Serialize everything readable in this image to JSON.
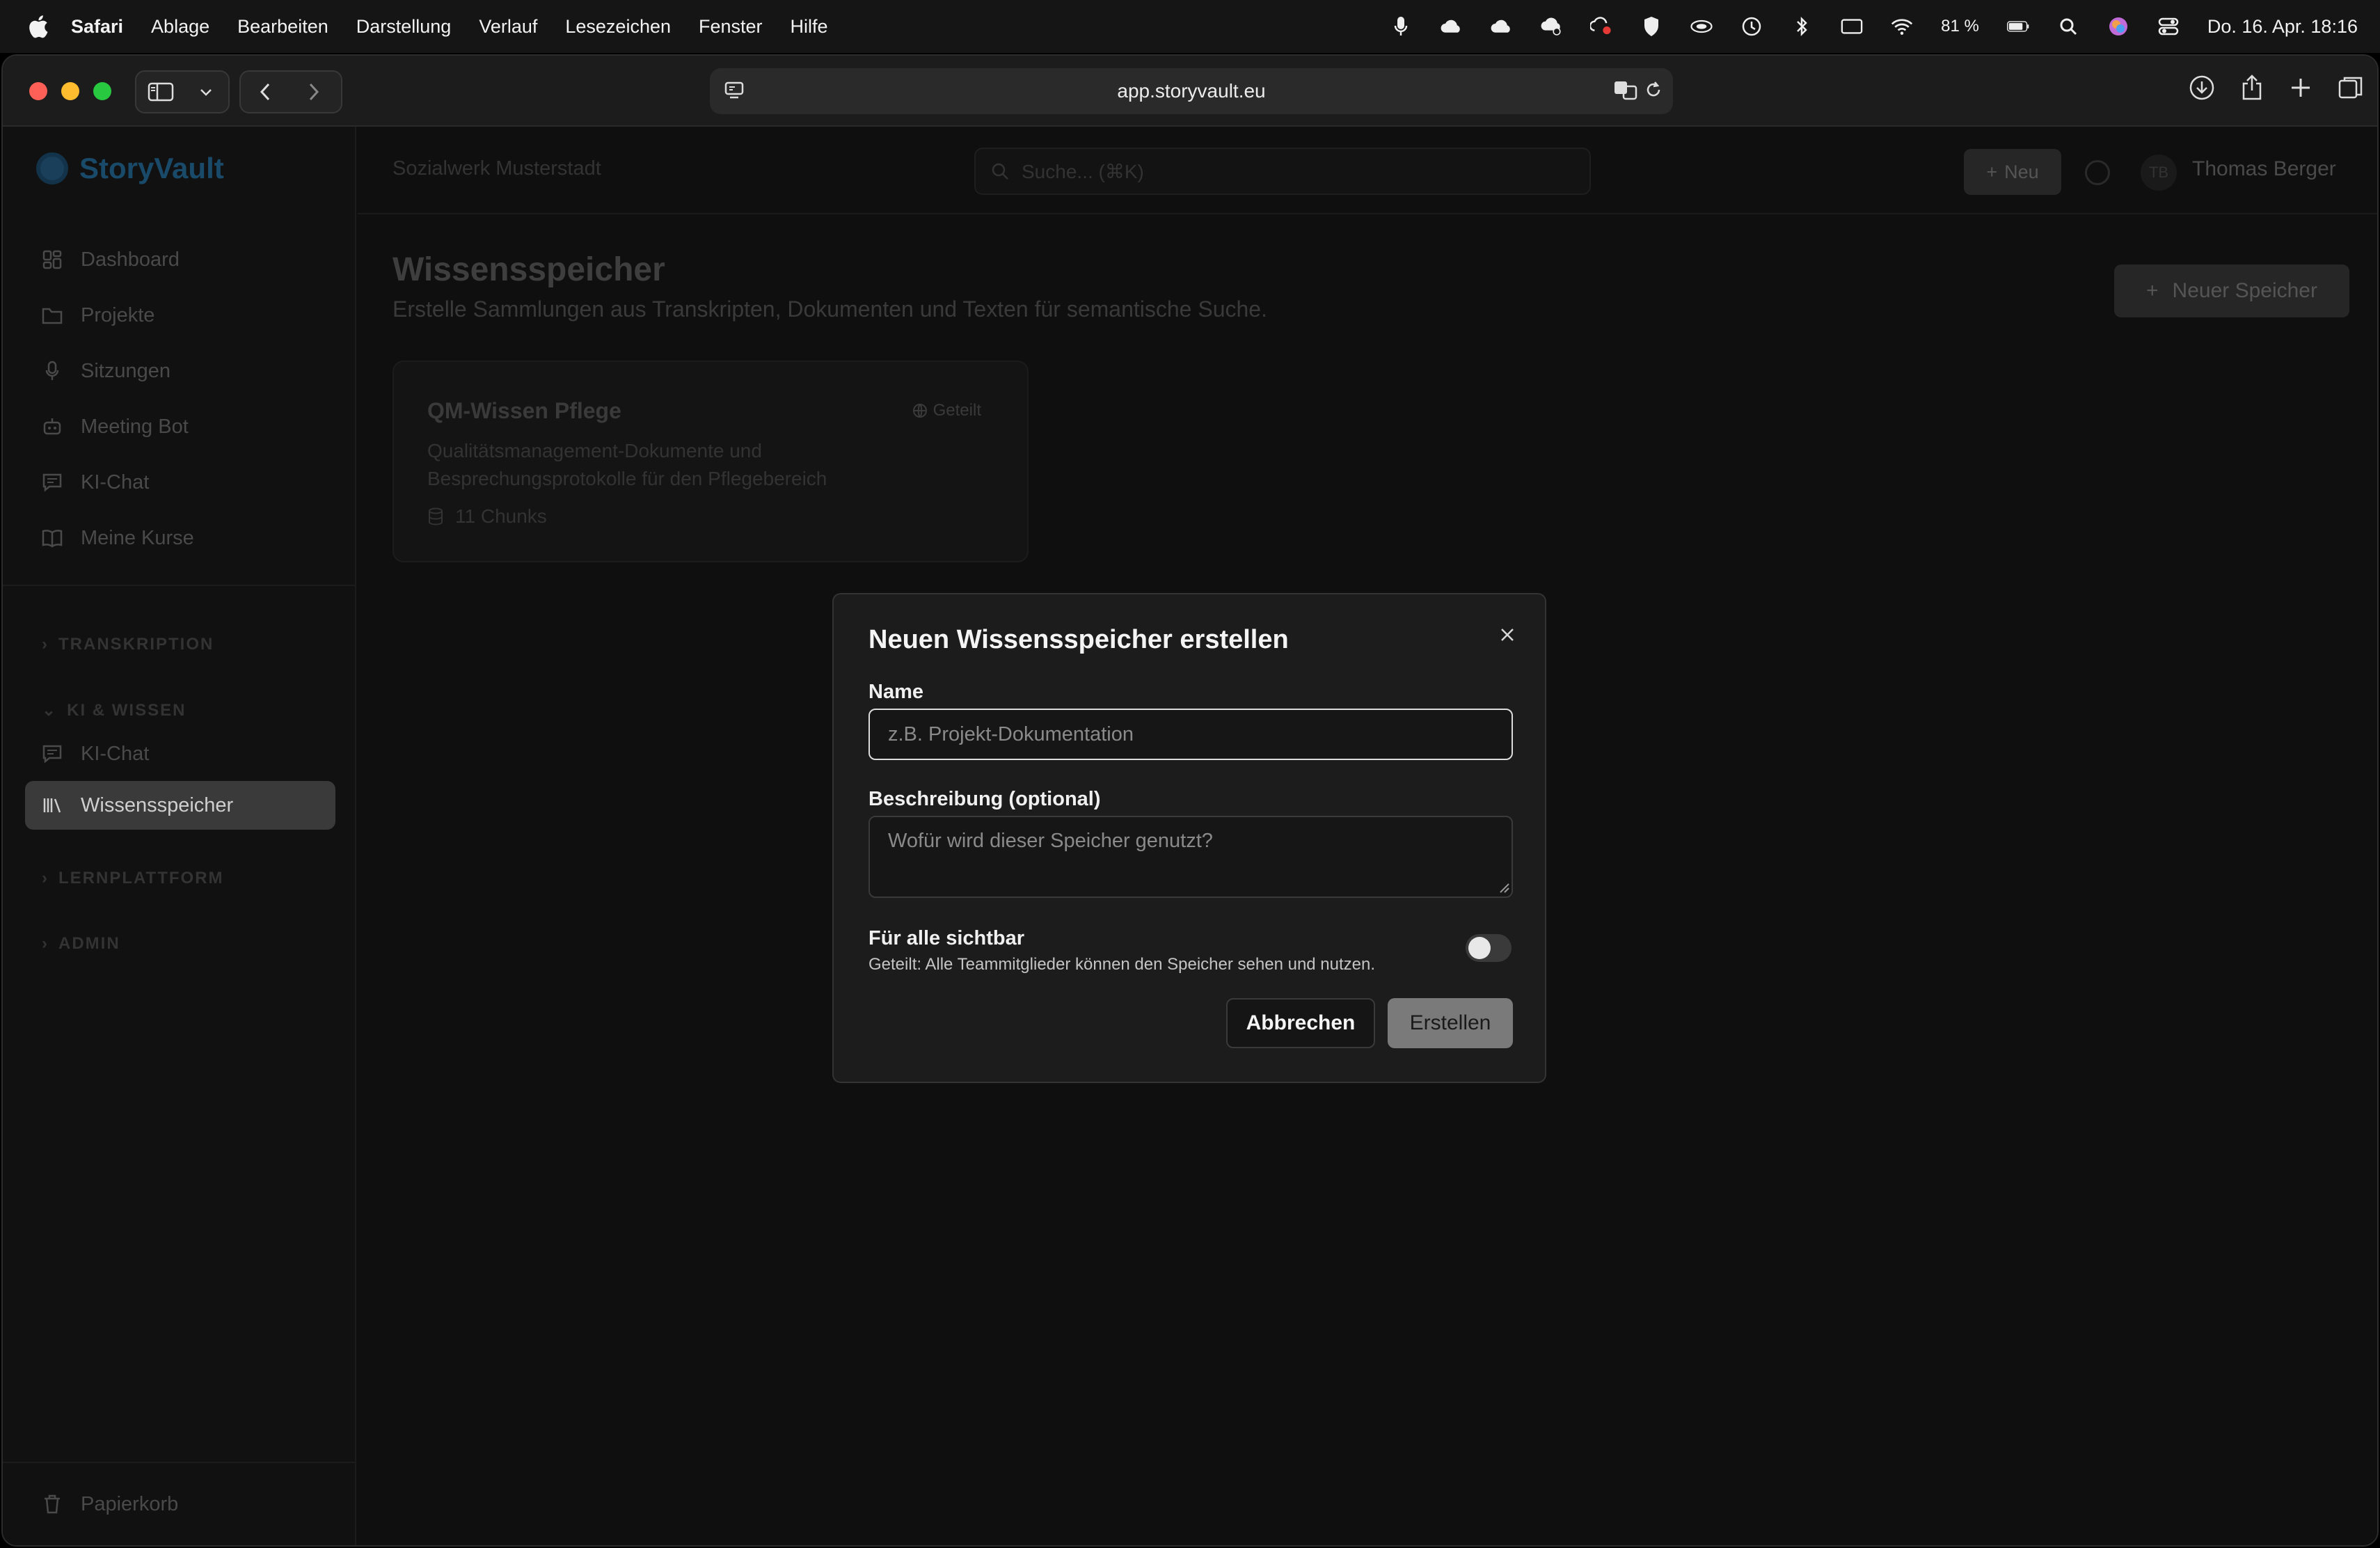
{
  "menubar": {
    "app": "Safari",
    "items": [
      "Ablage",
      "Bearbeiten",
      "Darstellung",
      "Verlauf",
      "Lesezeichen",
      "Fenster",
      "Hilfe"
    ],
    "battery": "81 %",
    "datetime": "Do. 16. Apr.  18:16"
  },
  "browser": {
    "url": "app.storyvault.eu"
  },
  "app": {
    "brand": "StoryVault",
    "org": "Sozialwerk Musterstadt",
    "search_placeholder": "Suche... (⌘K)",
    "new_label": "Neu",
    "user_initials": "TB",
    "user_name": "Thomas Berger",
    "accent_color": "#1a4a6a"
  },
  "sidebar": {
    "main": [
      "Dashboard",
      "Projekte",
      "Sitzungen",
      "Meeting Bot",
      "KI-Chat",
      "Meine Kurse"
    ],
    "sections": {
      "transkription": "TRANSKRIPTION",
      "ki_wissen": "KI & WISSEN",
      "lernplattform": "LERNPLATTFORM",
      "admin": "ADMIN"
    },
    "ki_items": [
      "KI-Chat",
      "Wissensspeicher"
    ],
    "active": "Wissensspeicher",
    "trash": "Papierkorb"
  },
  "page": {
    "title": "Wissensspeicher",
    "subtitle": "Erstelle Sammlungen aus Transkripten, Dokumenten und Texten für semantische Suche.",
    "new_store_label": "Neuer Speicher",
    "card": {
      "title": "QM-Wissen Pflege",
      "badge": "Geteilt",
      "description": "Qualitätsmanagement-Dokumente und Besprechungsprotokolle für den Pflegebereich",
      "chunks": "11 Chunks"
    }
  },
  "dialog": {
    "title": "Neuen Wissensspeicher erstellen",
    "name_label": "Name",
    "name_placeholder": "z.B. Projekt-Dokumentation",
    "name_value": "",
    "desc_label": "Beschreibung (optional)",
    "desc_placeholder": "Wofür wird dieser Speicher genutzt?",
    "visibility_label": "Für alle sichtbar",
    "visibility_hint": "Geteilt: Alle Teammitglieder können den Speicher sehen und nutzen.",
    "visibility_on": false,
    "cancel_label": "Abbrechen",
    "create_label": "Erstellen"
  }
}
